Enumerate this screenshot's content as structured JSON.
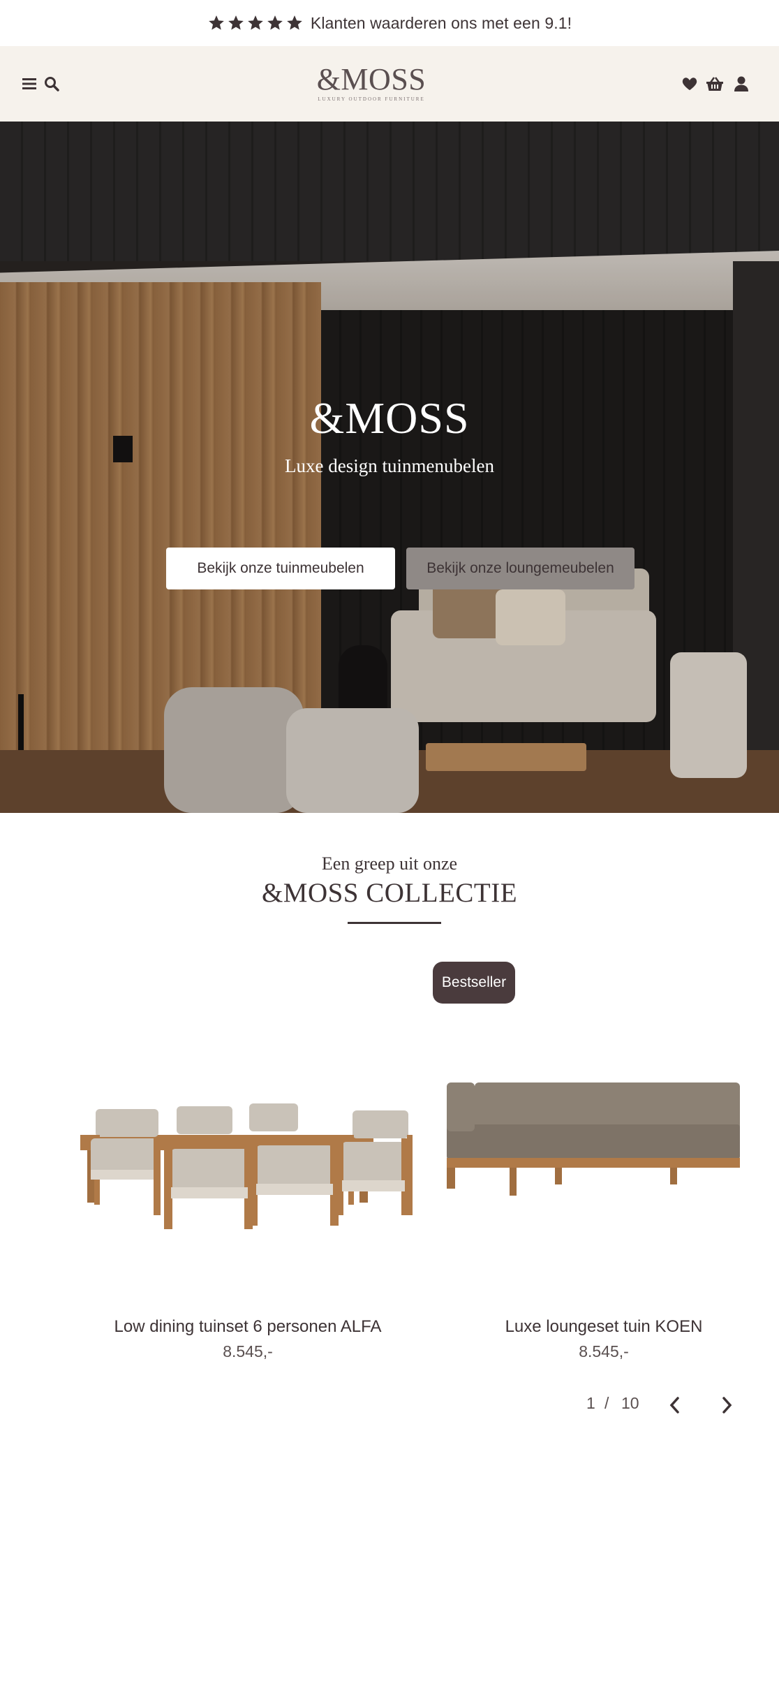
{
  "topbar": {
    "rating_text": "Klanten waarderen ons met een 9.1!",
    "stars": 5,
    "star_color": "#3d3335"
  },
  "header": {
    "logo_main": "&MOSS",
    "logo_sub": "Luxury outdoor furniture",
    "background": "#f6f2ec",
    "icons_left": [
      "menu-icon",
      "search-icon"
    ],
    "icons_right": [
      "heart-icon",
      "basket-icon",
      "user-icon"
    ]
  },
  "hero": {
    "logo": "&MOSS",
    "subtitle": "Luxe design tuinmenubelen",
    "button_primary": "Bekijk onze tuinmeubelen",
    "button_secondary": "Bekijk onze loungemeubelen"
  },
  "collection": {
    "pre_title": "Een greep uit onze",
    "title": "&MOSS COLLECTIE",
    "badge": "Bestseller",
    "products": [
      {
        "name": "Low dining tuinset 6 personen ALFA",
        "price": "8.545,-"
      },
      {
        "name": "Luxe loungeset tuin KOEN",
        "price": "8.545,-"
      }
    ],
    "pager": {
      "current": "1",
      "separator": "/",
      "total": "10"
    }
  },
  "colors": {
    "text": "#3d3335",
    "badge_bg": "#4a3b3d",
    "secondary_button_bg": "#8f8986"
  }
}
